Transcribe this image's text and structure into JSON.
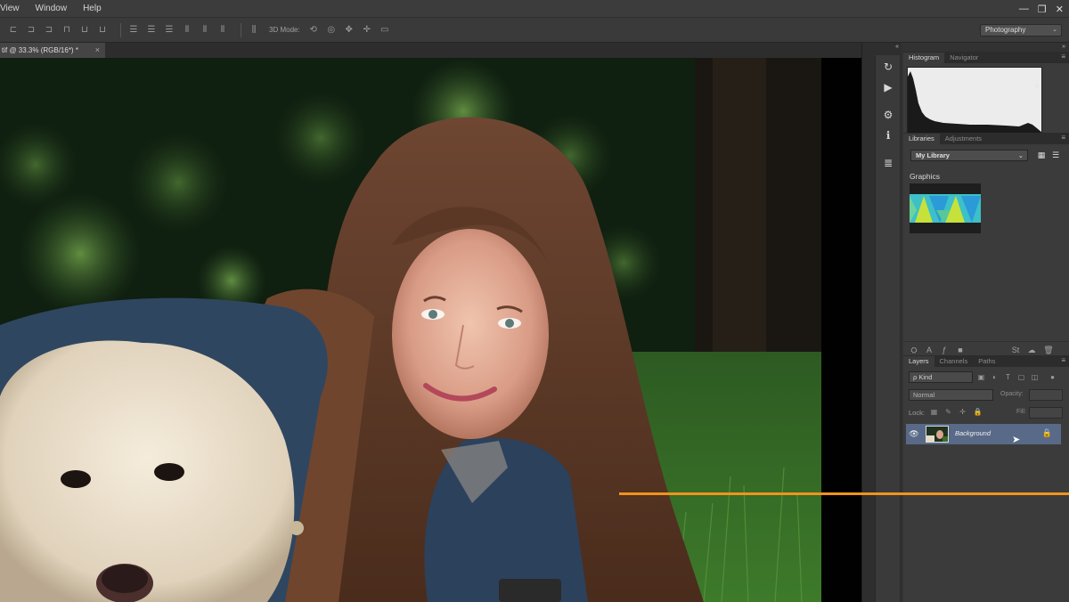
{
  "menu": {
    "items": [
      "View",
      "Window",
      "Help"
    ]
  },
  "window_controls": {
    "minimize": "—",
    "restore": "❐",
    "close": "✕"
  },
  "options_bar": {
    "mode_label": "3D Mode:",
    "workspace": "Photography"
  },
  "document": {
    "tab_title": "tif @ 33.3% (RGB/16*) *",
    "close_glyph": "×"
  },
  "panels": {
    "histogram": {
      "tabs": [
        "Histogram",
        "Navigator"
      ],
      "warning_glyph": "▲"
    },
    "libraries": {
      "tabs": [
        "Libraries",
        "Adjustments"
      ],
      "library_name": "My Library",
      "section_label": "Graphics"
    },
    "layers": {
      "tabs": [
        "Layers",
        "Channels",
        "Paths"
      ],
      "filter_kind": "ρ Kind",
      "blend_mode": "Normal",
      "opacity_label": "Opacity:",
      "lock_label": "Lock:",
      "fill_label": "Fill:",
      "layer_name": "Background"
    }
  },
  "colors": {
    "accent_line": "#f0941c",
    "selected_layer": "#596a88"
  }
}
